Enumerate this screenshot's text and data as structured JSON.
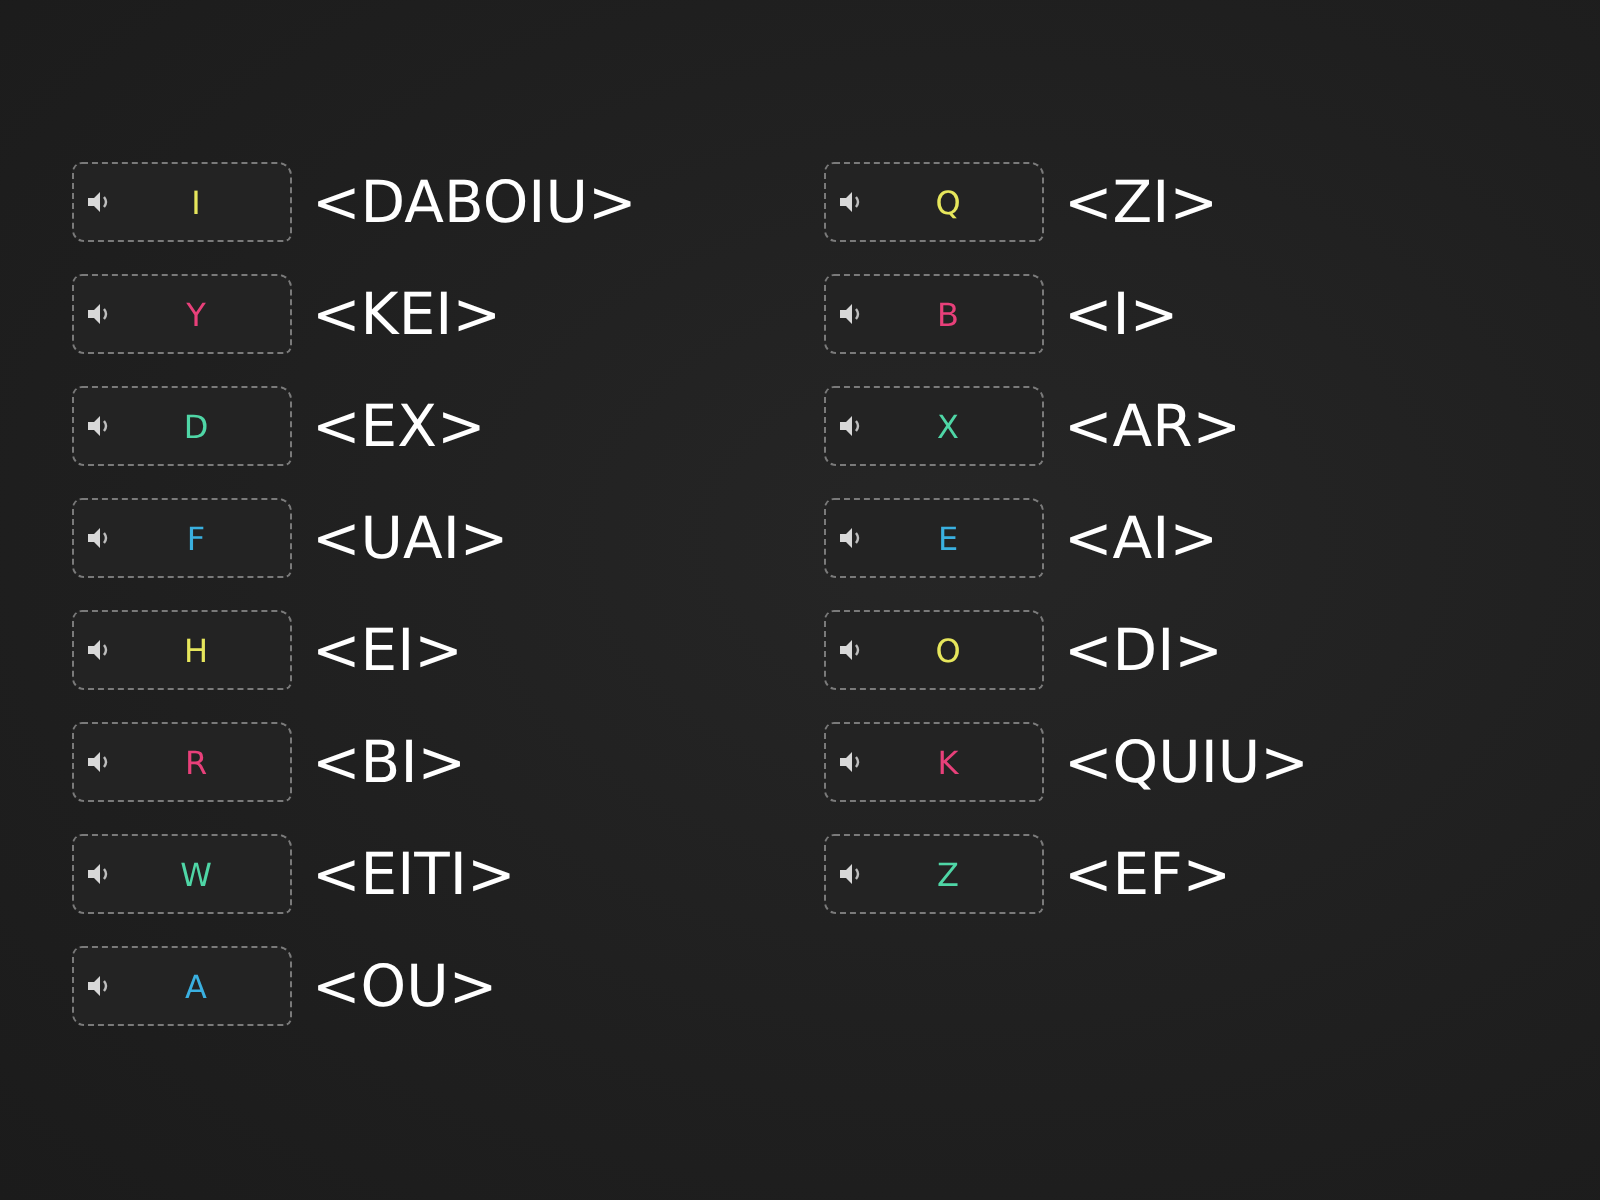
{
  "columns": [
    {
      "items": [
        {
          "letter": "I",
          "color": "#e6e65c",
          "answer": "<DABOIU>"
        },
        {
          "letter": "Y",
          "color": "#e8407a",
          "answer": "<KEI>"
        },
        {
          "letter": "D",
          "color": "#4fd6a6",
          "answer": "<EX>"
        },
        {
          "letter": "F",
          "color": "#3ab0e0",
          "answer": "<UAI>"
        },
        {
          "letter": "H",
          "color": "#e6e65c",
          "answer": "<EI>"
        },
        {
          "letter": "R",
          "color": "#e8407a",
          "answer": "<BI>"
        },
        {
          "letter": "W",
          "color": "#4fd6a6",
          "answer": "<EITI>"
        },
        {
          "letter": "A",
          "color": "#3ab0e0",
          "answer": "<OU>"
        }
      ]
    },
    {
      "items": [
        {
          "letter": "Q",
          "color": "#e6e65c",
          "answer": "<ZI>"
        },
        {
          "letter": "B",
          "color": "#e8407a",
          "answer": "<I>"
        },
        {
          "letter": "X",
          "color": "#4fd6a6",
          "answer": "<AR>"
        },
        {
          "letter": "E",
          "color": "#3ab0e0",
          "answer": "<AI>"
        },
        {
          "letter": "O",
          "color": "#e6e65c",
          "answer": "<DI>"
        },
        {
          "letter": "K",
          "color": "#e8407a",
          "answer": "<QUIU>"
        },
        {
          "letter": "Z",
          "color": "#4fd6a6",
          "answer": "<EF>"
        }
      ]
    }
  ]
}
